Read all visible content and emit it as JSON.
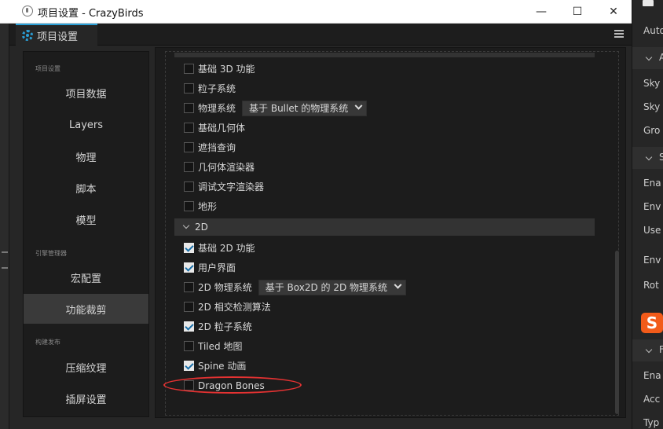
{
  "window": {
    "title": "项目设置 - CrazyBirds",
    "minimize": "—",
    "maximize": "☐",
    "close": "✕"
  },
  "tab": {
    "label": "项目设置"
  },
  "sidebar": {
    "groups": [
      {
        "header": "项目设置",
        "items": [
          "项目数据",
          "Layers",
          "物理",
          "脚本",
          "模型"
        ]
      },
      {
        "header": "引擎管理器",
        "items": [
          "宏配置",
          "功能裁剪"
        ]
      },
      {
        "header": "构建发布",
        "items": [
          "压缩纹理",
          "插屏设置"
        ]
      }
    ],
    "active_item": "功能裁剪"
  },
  "features": {
    "rows_3d": [
      {
        "label": "基础 3D 功能",
        "checked": false
      },
      {
        "label": "粒子系统",
        "checked": false
      },
      {
        "label": "物理系统",
        "checked": false,
        "select": "基于 Bullet 的物理系统"
      },
      {
        "label": "基础几何体",
        "checked": false
      },
      {
        "label": "遮挡查询",
        "checked": false
      },
      {
        "label": "几何体渲染器",
        "checked": false
      },
      {
        "label": "调试文字渲染器",
        "checked": false
      },
      {
        "label": "地形",
        "checked": false
      }
    ],
    "section_2d": "2D",
    "rows_2d": [
      {
        "label": "基础 2D 功能",
        "checked": true
      },
      {
        "label": "用户界面",
        "checked": true
      },
      {
        "label": "2D 物理系统",
        "checked": false,
        "select": "基于 Box2D 的 2D 物理系统"
      },
      {
        "label": "2D 相交检测算法",
        "checked": false
      },
      {
        "label": "2D 粒子系统",
        "checked": true
      },
      {
        "label": "Tiled 地图",
        "checked": false
      },
      {
        "label": "Spine 动画",
        "checked": true
      },
      {
        "label": "Dragon Bones",
        "checked": false
      }
    ]
  },
  "inspector": {
    "rows": [
      {
        "type": "label",
        "text": "Auto"
      },
      {
        "type": "header",
        "text": "A"
      },
      {
        "type": "label",
        "text": "Sky"
      },
      {
        "type": "label",
        "text": "Sky"
      },
      {
        "type": "label",
        "text": "Gro"
      },
      {
        "type": "header",
        "text": "S"
      },
      {
        "type": "label",
        "text": "Ena"
      },
      {
        "type": "label",
        "text": "Env"
      },
      {
        "type": "label",
        "text": "Use"
      },
      {
        "type": "label",
        "text": "Env"
      },
      {
        "type": "label",
        "text": "Rot"
      },
      {
        "type": "header",
        "text": "F"
      },
      {
        "type": "label",
        "text": "Ena"
      },
      {
        "type": "label",
        "text": "Acc"
      },
      {
        "type": "label",
        "text": "Typ"
      }
    ],
    "logo": "S"
  },
  "colors": {
    "accent": "#2aa0d8",
    "highlight": "#e53232",
    "logo": "#f25b1a"
  }
}
